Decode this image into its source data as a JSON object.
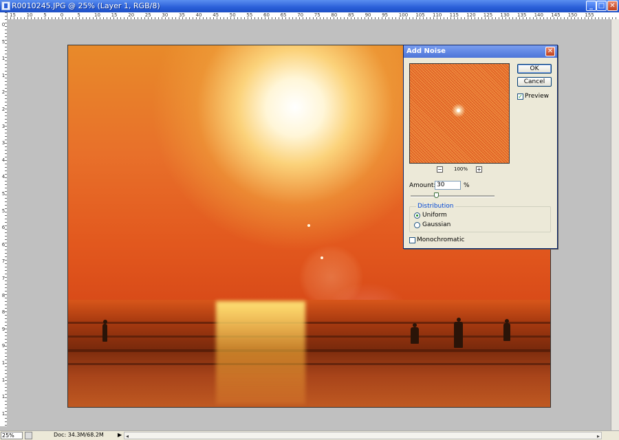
{
  "window": {
    "title": "R0010245.JPG @ 25% (Layer 1, RGB/8)",
    "minimize": "_",
    "maximize": "□",
    "close": "✕"
  },
  "ruler": {
    "top": [
      "15",
      "10",
      "5",
      "0",
      "5",
      "10",
      "15",
      "20",
      "25",
      "30",
      "35",
      "40",
      "45",
      "50",
      "55",
      "60",
      "65",
      "70",
      "75",
      "80",
      "85",
      "90",
      "95",
      "100",
      "105",
      "110",
      "115",
      "120",
      "125",
      "130",
      "135",
      "140",
      "145",
      "150",
      "155"
    ],
    "left": [
      "0",
      "5",
      "10",
      "15",
      "20",
      "25",
      "30",
      "35",
      "40",
      "45",
      "50",
      "55",
      "60",
      "65",
      "70",
      "75",
      "80",
      "85",
      "90",
      "95",
      "100",
      "105",
      "110",
      "115"
    ]
  },
  "dialog": {
    "title": "Add Noise",
    "close": "✕",
    "ok_label": "OK",
    "cancel_label": "Cancel",
    "preview_label": "Preview",
    "preview_checked": true,
    "zoom_out": "−",
    "zoom_in": "+",
    "zoom_level": "100%",
    "amount_label": "Amount:",
    "amount_value": "30",
    "amount_unit": "%",
    "amount_fraction": 0.3,
    "distribution_title": "Distribution",
    "uniform_label": "Uniform",
    "gaussian_label": "Gaussian",
    "distribution_selected": "Uniform",
    "monochromatic_label": "Monochromatic",
    "monochromatic_checked": false
  },
  "status": {
    "zoom": "25%",
    "doc": "Doc: 34.3M/68.2M",
    "arrow": "▶"
  },
  "colors": {
    "accent": "#2a5fd8",
    "dialog_bg": "#ece9d8"
  }
}
